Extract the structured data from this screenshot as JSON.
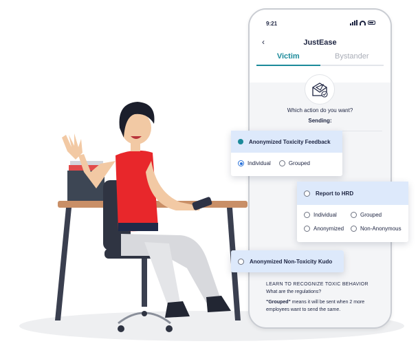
{
  "status": {
    "time": "9:21"
  },
  "header": {
    "title": "JustEase"
  },
  "tabs": [
    {
      "label": "Victim"
    },
    {
      "label": "Bystander"
    }
  ],
  "prompt": {
    "question": "Which action do you want?",
    "sending": "Sending:"
  },
  "cards": {
    "toxicity": {
      "title": "Anonymized Toxicity Feedback",
      "options": [
        "Individual",
        "Grouped"
      ],
      "selected": "Individual"
    },
    "hrd": {
      "title": "Report to HRD",
      "options": [
        "Individual",
        "Grouped",
        "Anonymized",
        "Non-Anonymous"
      ]
    },
    "kudo": {
      "title": "Anonymized Non-Toxicity Kudo"
    }
  },
  "learn": {
    "heading": "LEARN TO RECOGNIZE TOXIC BEHAVIOR",
    "subheading": "What are the regulations?",
    "grouped_term": "\"Grouped\"",
    "grouped_text": " means it will be sent when 2 more employees want to send the same."
  },
  "colors": {
    "accent": "#1b8a9a",
    "card_header": "#dde9fb",
    "radio_selected": "#2b73d9",
    "shirt": "#e8272b"
  },
  "icons": {
    "back": "chevron-left-icon",
    "envelope": "envelope-send-icon"
  }
}
